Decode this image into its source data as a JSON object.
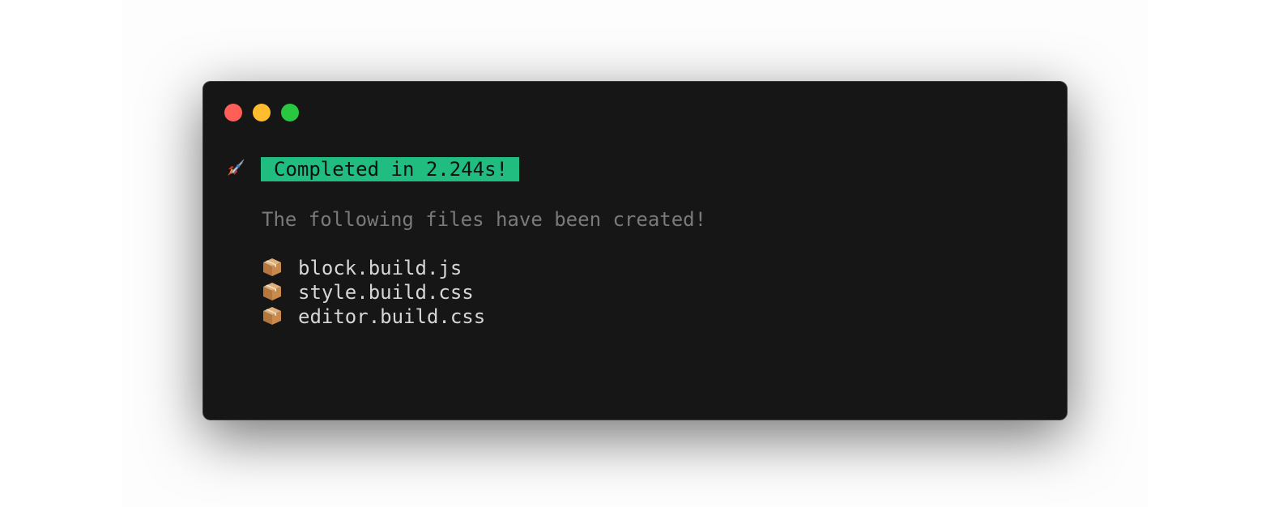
{
  "window": {
    "controls": [
      {
        "name": "close",
        "color": "#ff5f57"
      },
      {
        "name": "minimize",
        "color": "#febc2e"
      },
      {
        "name": "maximize",
        "color": "#28c840"
      }
    ]
  },
  "output": {
    "status_icon": "rocket-icon",
    "status": "Completed in 2.244s!",
    "status_color": "#21bc80",
    "message": "The following files have been created!",
    "files": [
      {
        "icon": "package-icon",
        "name": "block.build.js"
      },
      {
        "icon": "package-icon",
        "name": "style.build.css"
      },
      {
        "icon": "package-icon",
        "name": "editor.build.css"
      }
    ]
  }
}
